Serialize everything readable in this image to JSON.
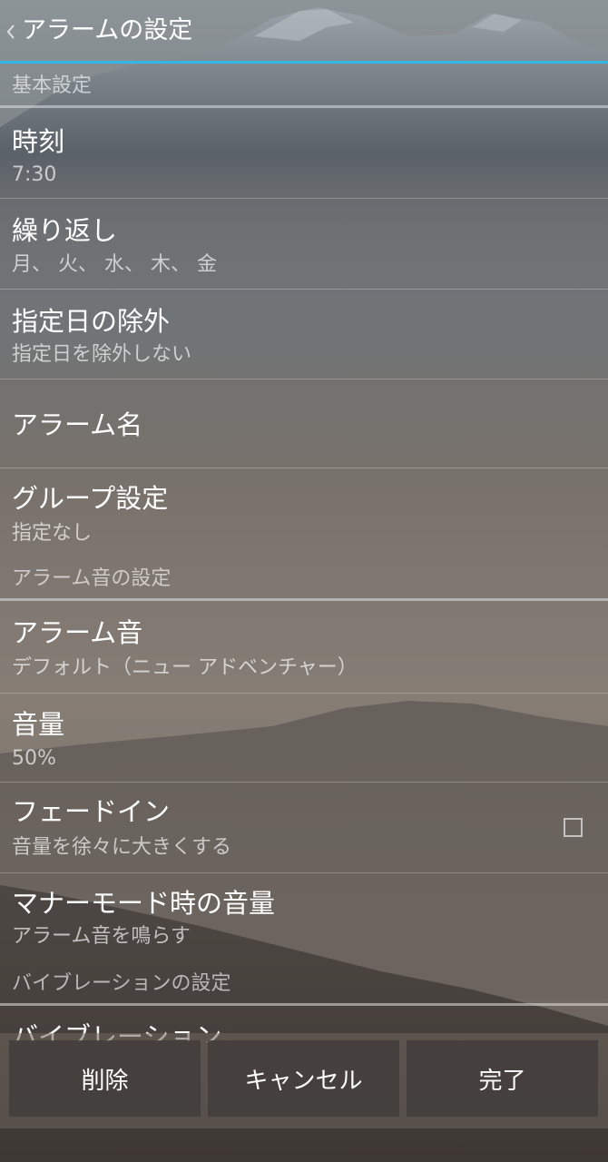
{
  "header": {
    "title": "アラームの設定"
  },
  "sections": {
    "basic": "基本設定",
    "sound": "アラーム音の設定",
    "vibration": "バイブレーションの設定"
  },
  "items": {
    "time": {
      "title": "時刻",
      "value": "7:30"
    },
    "repeat": {
      "title": "繰り返し",
      "value": "月、 火、 水、 木、 金"
    },
    "exclude": {
      "title": "指定日の除外",
      "value": "指定日を除外しない"
    },
    "name": {
      "title": "アラーム名"
    },
    "group": {
      "title": "グループ設定",
      "value": "指定なし"
    },
    "sound": {
      "title": "アラーム音",
      "value": "デフォルト（ニュー アドベンチャー）"
    },
    "volume": {
      "title": "音量",
      "value": "50%"
    },
    "fadein": {
      "title": "フェードイン",
      "value": "音量を徐々に大きくする",
      "checked": false
    },
    "manner": {
      "title": "マナーモード時の音量",
      "value": "アラーム音を鳴らす"
    },
    "vibration": {
      "title": "バイブレーション"
    }
  },
  "buttons": {
    "delete": "削除",
    "cancel": "キャンセル",
    "done": "完了"
  }
}
